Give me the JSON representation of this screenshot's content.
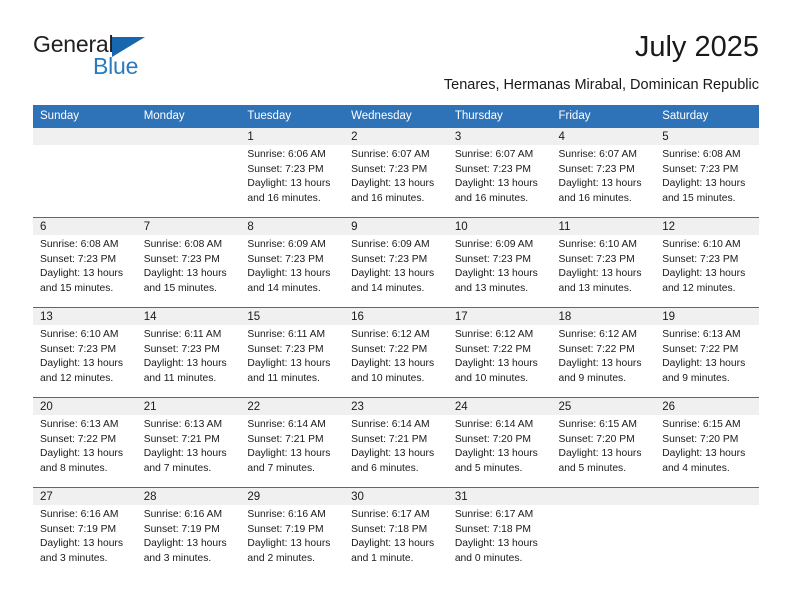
{
  "brand": {
    "line1": "General",
    "line2": "Blue",
    "triangle_color": "#1667ae",
    "text_color": "#231f20",
    "blue_text_color": "#2a7ac0"
  },
  "header": {
    "month_title": "July 2025",
    "location": "Tenares, Hermanas Mirabal, Dominican Republic"
  },
  "theme": {
    "header_blue": "#2e72b8",
    "daynum_band": "#f0f0f0",
    "text": "#1a1a1a"
  },
  "weekday_headers": [
    "Sunday",
    "Monday",
    "Tuesday",
    "Wednesday",
    "Thursday",
    "Friday",
    "Saturday"
  ],
  "weeks": [
    [
      {
        "day": "",
        "sunrise": "",
        "sunset": "",
        "daylight_1": "",
        "daylight_2": "",
        "empty": true
      },
      {
        "day": "",
        "sunrise": "",
        "sunset": "",
        "daylight_1": "",
        "daylight_2": "",
        "empty": true
      },
      {
        "day": "1",
        "sunrise": "Sunrise: 6:06 AM",
        "sunset": "Sunset: 7:23 PM",
        "daylight_1": "Daylight: 13 hours",
        "daylight_2": "and 16 minutes."
      },
      {
        "day": "2",
        "sunrise": "Sunrise: 6:07 AM",
        "sunset": "Sunset: 7:23 PM",
        "daylight_1": "Daylight: 13 hours",
        "daylight_2": "and 16 minutes."
      },
      {
        "day": "3",
        "sunrise": "Sunrise: 6:07 AM",
        "sunset": "Sunset: 7:23 PM",
        "daylight_1": "Daylight: 13 hours",
        "daylight_2": "and 16 minutes."
      },
      {
        "day": "4",
        "sunrise": "Sunrise: 6:07 AM",
        "sunset": "Sunset: 7:23 PM",
        "daylight_1": "Daylight: 13 hours",
        "daylight_2": "and 16 minutes."
      },
      {
        "day": "5",
        "sunrise": "Sunrise: 6:08 AM",
        "sunset": "Sunset: 7:23 PM",
        "daylight_1": "Daylight: 13 hours",
        "daylight_2": "and 15 minutes."
      }
    ],
    [
      {
        "day": "6",
        "sunrise": "Sunrise: 6:08 AM",
        "sunset": "Sunset: 7:23 PM",
        "daylight_1": "Daylight: 13 hours",
        "daylight_2": "and 15 minutes."
      },
      {
        "day": "7",
        "sunrise": "Sunrise: 6:08 AM",
        "sunset": "Sunset: 7:23 PM",
        "daylight_1": "Daylight: 13 hours",
        "daylight_2": "and 15 minutes."
      },
      {
        "day": "8",
        "sunrise": "Sunrise: 6:09 AM",
        "sunset": "Sunset: 7:23 PM",
        "daylight_1": "Daylight: 13 hours",
        "daylight_2": "and 14 minutes."
      },
      {
        "day": "9",
        "sunrise": "Sunrise: 6:09 AM",
        "sunset": "Sunset: 7:23 PM",
        "daylight_1": "Daylight: 13 hours",
        "daylight_2": "and 14 minutes."
      },
      {
        "day": "10",
        "sunrise": "Sunrise: 6:09 AM",
        "sunset": "Sunset: 7:23 PM",
        "daylight_1": "Daylight: 13 hours",
        "daylight_2": "and 13 minutes."
      },
      {
        "day": "11",
        "sunrise": "Sunrise: 6:10 AM",
        "sunset": "Sunset: 7:23 PM",
        "daylight_1": "Daylight: 13 hours",
        "daylight_2": "and 13 minutes."
      },
      {
        "day": "12",
        "sunrise": "Sunrise: 6:10 AM",
        "sunset": "Sunset: 7:23 PM",
        "daylight_1": "Daylight: 13 hours",
        "daylight_2": "and 12 minutes."
      }
    ],
    [
      {
        "day": "13",
        "sunrise": "Sunrise: 6:10 AM",
        "sunset": "Sunset: 7:23 PM",
        "daylight_1": "Daylight: 13 hours",
        "daylight_2": "and 12 minutes."
      },
      {
        "day": "14",
        "sunrise": "Sunrise: 6:11 AM",
        "sunset": "Sunset: 7:23 PM",
        "daylight_1": "Daylight: 13 hours",
        "daylight_2": "and 11 minutes."
      },
      {
        "day": "15",
        "sunrise": "Sunrise: 6:11 AM",
        "sunset": "Sunset: 7:23 PM",
        "daylight_1": "Daylight: 13 hours",
        "daylight_2": "and 11 minutes."
      },
      {
        "day": "16",
        "sunrise": "Sunrise: 6:12 AM",
        "sunset": "Sunset: 7:22 PM",
        "daylight_1": "Daylight: 13 hours",
        "daylight_2": "and 10 minutes."
      },
      {
        "day": "17",
        "sunrise": "Sunrise: 6:12 AM",
        "sunset": "Sunset: 7:22 PM",
        "daylight_1": "Daylight: 13 hours",
        "daylight_2": "and 10 minutes."
      },
      {
        "day": "18",
        "sunrise": "Sunrise: 6:12 AM",
        "sunset": "Sunset: 7:22 PM",
        "daylight_1": "Daylight: 13 hours",
        "daylight_2": "and 9 minutes."
      },
      {
        "day": "19",
        "sunrise": "Sunrise: 6:13 AM",
        "sunset": "Sunset: 7:22 PM",
        "daylight_1": "Daylight: 13 hours",
        "daylight_2": "and 9 minutes."
      }
    ],
    [
      {
        "day": "20",
        "sunrise": "Sunrise: 6:13 AM",
        "sunset": "Sunset: 7:22 PM",
        "daylight_1": "Daylight: 13 hours",
        "daylight_2": "and 8 minutes."
      },
      {
        "day": "21",
        "sunrise": "Sunrise: 6:13 AM",
        "sunset": "Sunset: 7:21 PM",
        "daylight_1": "Daylight: 13 hours",
        "daylight_2": "and 7 minutes."
      },
      {
        "day": "22",
        "sunrise": "Sunrise: 6:14 AM",
        "sunset": "Sunset: 7:21 PM",
        "daylight_1": "Daylight: 13 hours",
        "daylight_2": "and 7 minutes."
      },
      {
        "day": "23",
        "sunrise": "Sunrise: 6:14 AM",
        "sunset": "Sunset: 7:21 PM",
        "daylight_1": "Daylight: 13 hours",
        "daylight_2": "and 6 minutes."
      },
      {
        "day": "24",
        "sunrise": "Sunrise: 6:14 AM",
        "sunset": "Sunset: 7:20 PM",
        "daylight_1": "Daylight: 13 hours",
        "daylight_2": "and 5 minutes."
      },
      {
        "day": "25",
        "sunrise": "Sunrise: 6:15 AM",
        "sunset": "Sunset: 7:20 PM",
        "daylight_1": "Daylight: 13 hours",
        "daylight_2": "and 5 minutes."
      },
      {
        "day": "26",
        "sunrise": "Sunrise: 6:15 AM",
        "sunset": "Sunset: 7:20 PM",
        "daylight_1": "Daylight: 13 hours",
        "daylight_2": "and 4 minutes."
      }
    ],
    [
      {
        "day": "27",
        "sunrise": "Sunrise: 6:16 AM",
        "sunset": "Sunset: 7:19 PM",
        "daylight_1": "Daylight: 13 hours",
        "daylight_2": "and 3 minutes."
      },
      {
        "day": "28",
        "sunrise": "Sunrise: 6:16 AM",
        "sunset": "Sunset: 7:19 PM",
        "daylight_1": "Daylight: 13 hours",
        "daylight_2": "and 3 minutes."
      },
      {
        "day": "29",
        "sunrise": "Sunrise: 6:16 AM",
        "sunset": "Sunset: 7:19 PM",
        "daylight_1": "Daylight: 13 hours",
        "daylight_2": "and 2 minutes."
      },
      {
        "day": "30",
        "sunrise": "Sunrise: 6:17 AM",
        "sunset": "Sunset: 7:18 PM",
        "daylight_1": "Daylight: 13 hours",
        "daylight_2": "and 1 minute."
      },
      {
        "day": "31",
        "sunrise": "Sunrise: 6:17 AM",
        "sunset": "Sunset: 7:18 PM",
        "daylight_1": "Daylight: 13 hours",
        "daylight_2": "and 0 minutes."
      },
      {
        "day": "",
        "sunrise": "",
        "sunset": "",
        "daylight_1": "",
        "daylight_2": "",
        "empty": true
      },
      {
        "day": "",
        "sunrise": "",
        "sunset": "",
        "daylight_1": "",
        "daylight_2": "",
        "empty": true
      }
    ]
  ]
}
